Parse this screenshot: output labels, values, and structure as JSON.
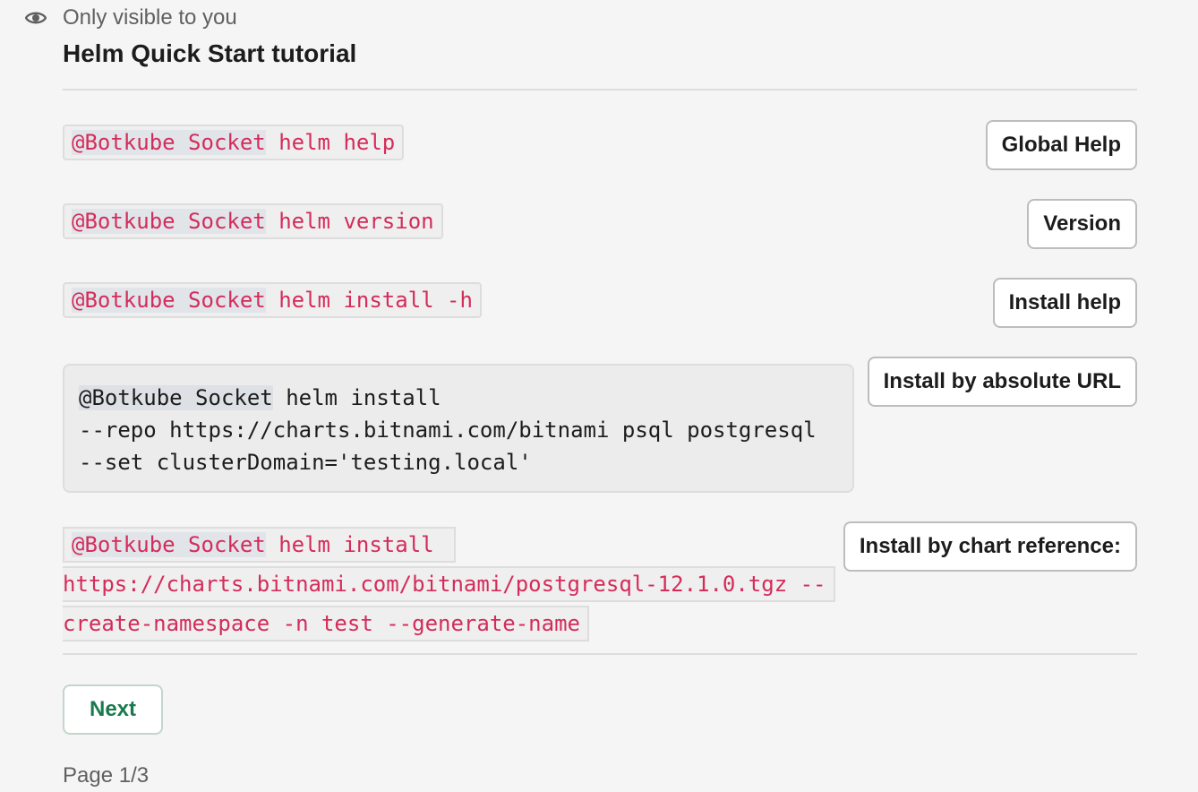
{
  "visibility": {
    "icon": "eye-icon",
    "text": "Only visible to you"
  },
  "title": "Helm Quick Start tutorial",
  "rows": [
    {
      "mention": "@Botkube Socket",
      "command": " helm help",
      "button": "Global Help"
    },
    {
      "mention": "@Botkube Socket",
      "command": " helm version",
      "button": "Version"
    },
    {
      "mention": "@Botkube Socket",
      "command": " helm install -h",
      "button": "Install help"
    }
  ],
  "code_block": {
    "mention": "@Botkube Socket",
    "line1": " helm install",
    "line2": "--repo https://charts.bitnami.com/bitnami psql postgresql",
    "line3": "--set clusterDomain='testing.local'",
    "button": "Install by absolute URL"
  },
  "chart_ref": {
    "mention": "@Botkube Socket",
    "line1": " helm install ",
    "line2": "https://charts.bitnami.com/bitnami/postgresql-12.1.0.tgz --",
    "line3": "create-namespace -n test --generate-name",
    "button": "Install by chart reference:"
  },
  "next_label": "Next",
  "page_label": "Page 1/3",
  "colors": {
    "code_text": "#d42c5a",
    "next_text": "#1a7a4f",
    "background": "#f5f5f5"
  }
}
